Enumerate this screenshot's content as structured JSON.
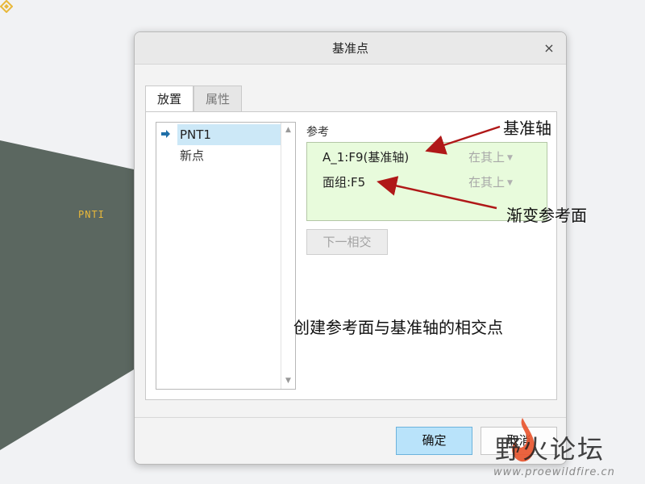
{
  "viewport": {
    "point_label": "PNTI",
    "colors": {
      "surface": "#5b6760",
      "point": "#e8b83a"
    }
  },
  "dialog": {
    "title": "基准点",
    "close_glyph": "×",
    "tabs": [
      {
        "label": "放置",
        "active": true
      },
      {
        "label": "属性",
        "active": false
      }
    ],
    "points_list": {
      "items": [
        {
          "label": "PNT1",
          "selected": true
        },
        {
          "label": "新点",
          "selected": false
        }
      ]
    },
    "references": {
      "label": "参考",
      "rows": [
        {
          "name": "A_1:F9(基准轴)",
          "option": "在其上"
        },
        {
          "name": "面组:F5",
          "option": "在其上"
        }
      ]
    },
    "next_intersection_label": "下一相交",
    "ok_label": "确定",
    "cancel_label": "取消"
  },
  "annotations": {
    "datum_axis": "基准轴",
    "gradient_ref_face": "渐变参考面",
    "note": "创建参考面与基准轴的相交点"
  },
  "watermark": {
    "title": "野火论坛",
    "url": "www.proewildfire.cn"
  }
}
